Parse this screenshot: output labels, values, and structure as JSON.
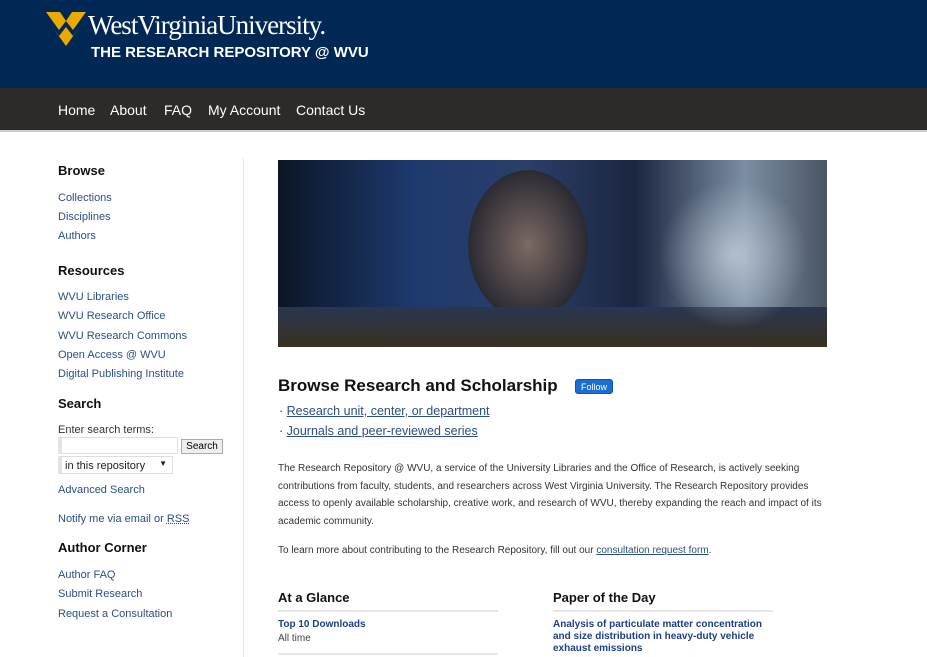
{
  "header": {
    "university": "WestVirginiaUniversity.",
    "title": "THE RESEARCH REPOSITORY @ WVU",
    "brand_color": "#002855",
    "gold": "#EAAA00"
  },
  "nav": [
    "Home",
    "About",
    "FAQ",
    "My Account",
    "Contact Us"
  ],
  "sidebar": {
    "browse": {
      "title": "Browse",
      "items": [
        "Collections",
        "Disciplines",
        "Authors"
      ]
    },
    "resources": {
      "title": "Resources",
      "items": [
        "WVU Libraries",
        "WVU Research Office",
        "WVU Research Commons",
        "Open Access @ WVU",
        "Digital Publishing Institute"
      ]
    },
    "search": {
      "title": "Search",
      "label": "Enter search terms:",
      "value": "",
      "button": "Search",
      "scope": "in this repository",
      "advanced": "Advanced Search",
      "notify": "Notify me via email or ",
      "rss": "RSS"
    },
    "author": {
      "title": "Author Corner",
      "items": [
        "Author FAQ",
        "Submit Research",
        "Request a Consultation"
      ]
    }
  },
  "main": {
    "title": "Browse Research and Scholarship",
    "follow": "Follow",
    "links": [
      "Research unit, center, or department",
      "Journals and peer-reviewed series"
    ],
    "intro": "The Research Repository @ WVU, a service of the University Libraries and the Office of Research, is actively seeking contributions from faculty, students, and researchers across West Virginia University. The Research Repository provides access to openly available scholarship, creative work, and research of WVU, thereby expanding the reach and impact of its academic community.",
    "learn": "To learn more about contributing to the Research Repository, fill out our ",
    "learn_link": "consultation request form",
    "glance": {
      "title": "At a Glance",
      "link": "Top 10 Downloads",
      "sub": "All time"
    },
    "paper": {
      "title": "Paper of the Day",
      "link": "Analysis of particulate matter concentration and size distribution in heavy-duty vehicle exhaust emissions"
    }
  }
}
